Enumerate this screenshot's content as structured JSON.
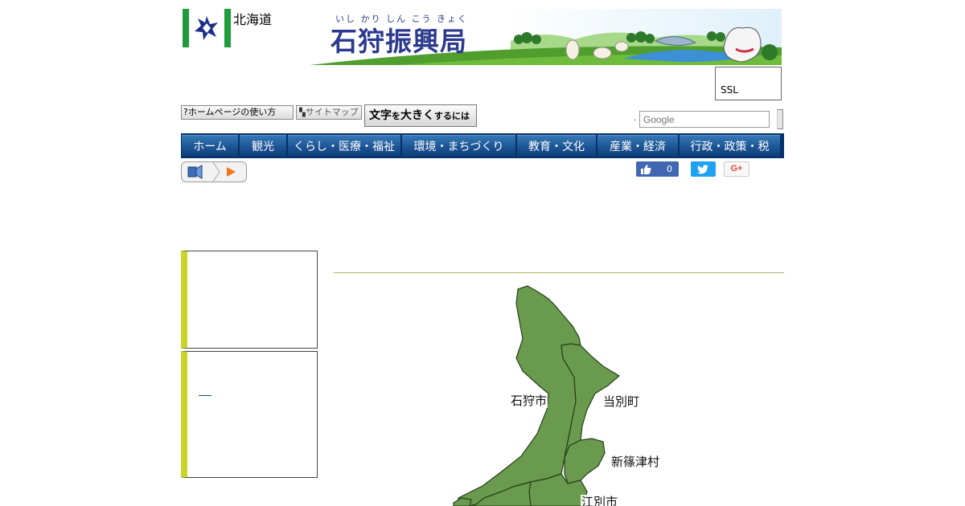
{
  "header": {
    "pref_name": "北海道",
    "banner_ruby": "いし かり しん こう きょく",
    "banner_title": "石狩振興局"
  },
  "ssl": {
    "label": "SSL"
  },
  "util": {
    "help_label": "?ホームページの使い方",
    "sitemap_label": "サイトマップ",
    "font_label_big": "文字",
    "font_label_small1": "を",
    "font_label_big2": "大きく",
    "font_label_small2": "するには"
  },
  "search": {
    "placeholder": "Google",
    "dot": "."
  },
  "nav": {
    "items": [
      {
        "label": "ホーム"
      },
      {
        "label": "観光"
      },
      {
        "label": "くらし・医療・福祉"
      },
      {
        "label": "環境・まちづくり"
      },
      {
        "label": "教育・文化"
      },
      {
        "label": "産業・経済"
      },
      {
        "label": "行政・政策・税"
      }
    ]
  },
  "social": {
    "like_count": "0",
    "gplus_label": "G+"
  },
  "map": {
    "fill_color": "#6a9a4e",
    "labels": [
      {
        "text": "石狩市"
      },
      {
        "text": "当別町"
      },
      {
        "text": "新篠津村"
      },
      {
        "text": "江別市"
      }
    ]
  },
  "colors": {
    "nav_bg": "#04326a",
    "side_accent": "#c8d62a",
    "brand_green": "#1e9b3a",
    "title_blue": "#2b3a8f"
  }
}
